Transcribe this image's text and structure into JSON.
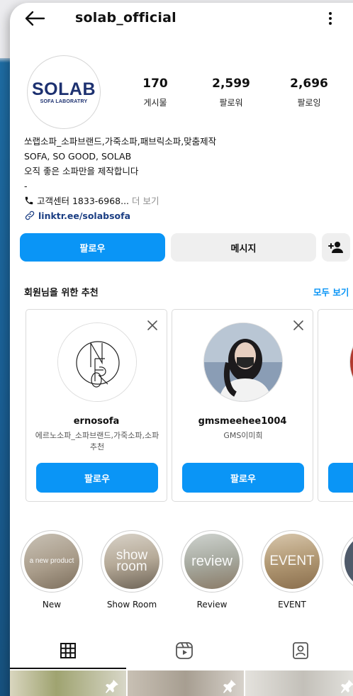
{
  "profile": {
    "username": "solab_official",
    "avatar_logo_main": "SOLAB",
    "avatar_logo_sub": "SOFA LABORATRY",
    "stats": [
      {
        "value": "170",
        "label": "게시물"
      },
      {
        "value": "2,599",
        "label": "팔로워"
      },
      {
        "value": "2,696",
        "label": "팔로잉"
      }
    ],
    "bio": {
      "line1": "쏘랩소파_소파브랜드,가죽소파,패브릭소파,맞춤제작",
      "line2": "SOFA, SO GOOD, SOLAB",
      "line3": "오직 좋은 소파만을 제작합니다",
      "line4": "-",
      "contact": "고객센터 1833-6968...",
      "more": " 더 보기",
      "link": "linktr.ee/solabsofa"
    }
  },
  "actions": {
    "follow": "팔로우",
    "message": "메시지"
  },
  "suggestions": {
    "title": "회원님을 위한 추천",
    "see_all": "모두 보기",
    "cards": [
      {
        "name": "ernosofa",
        "subtitle": "에르노소파_소파브랜드,가죽소파,소파추천",
        "follow": "팔로우"
      },
      {
        "name": "gmsmeehee1004",
        "subtitle": "GMS이미희",
        "follow": "팔로우"
      }
    ]
  },
  "highlights": [
    {
      "label": "New",
      "cover_text": "a new product"
    },
    {
      "label": "Show Room",
      "cover_text": "show room"
    },
    {
      "label": "Review",
      "cover_text": "review"
    },
    {
      "label": "EVENT",
      "cover_text": "EVENT"
    }
  ],
  "tabs": [
    "grid-icon",
    "reels-icon",
    "tagged-icon"
  ],
  "colors": {
    "accent": "#0A95F6",
    "link": "#1B3E83",
    "secondary_button": "#EFEFEF"
  }
}
